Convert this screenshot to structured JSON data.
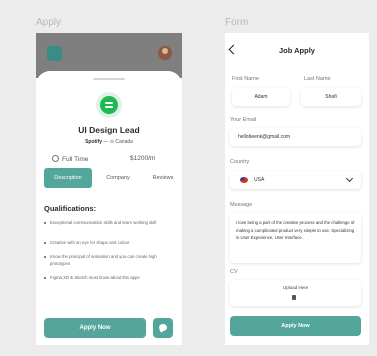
{
  "labels": {
    "apply": "Apply",
    "form": "Form"
  },
  "apply": {
    "job_title": "UI Design Lead",
    "company": "Spotify",
    "separator": "—",
    "location": "Canada",
    "job_type": "Full Time",
    "salary": "$1200/m",
    "tabs": [
      "Description",
      "Company",
      "Reviews"
    ],
    "qualifications_title": "Qualifications:",
    "qualifications": [
      "Exceptional communication skills and team working skill",
      "Creative with an eye for shape and colour",
      "Know the principal of animation and you can create high prototypes",
      "Figma,XD & Sketch must know about this apps"
    ],
    "apply_button": "Apply Now",
    "colors": {
      "accent": "#54a69a",
      "brand": "#1db954"
    }
  },
  "form": {
    "title": "Job Apply",
    "first_name_label": "First Name",
    "first_name_value": "Adam",
    "last_name_label": "Last Name",
    "last_name_value": "Shafi",
    "email_label": "Your Email",
    "email_value": "hellobeenk@gmail.com",
    "country_label": "Country",
    "country_value": "USA",
    "message_label": "Message",
    "message_value": "I love being a part of the creative process and the challenge of making a complicated product very simple to use. Specializing in User Experience, User Interface.",
    "cv_label": "CV",
    "upload_label": "Upload Here",
    "submit_button": "Apply Now"
  }
}
